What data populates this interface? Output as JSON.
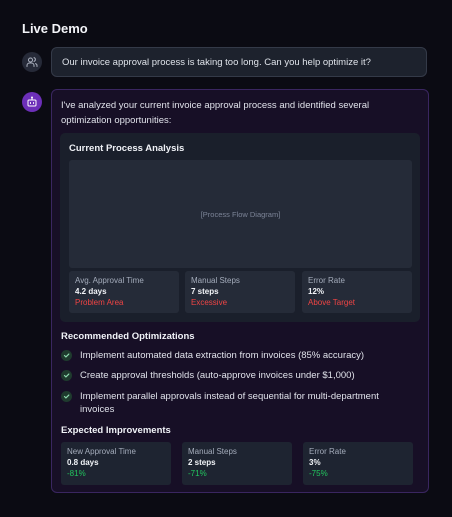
{
  "panel": {
    "title": "Live Demo"
  },
  "user_message": {
    "text": "Our invoice approval process is taking too long. Can you help optimize it?"
  },
  "assistant": {
    "intro": "I've analyzed your current invoice approval process and identified several optimization opportunities:",
    "analysis": {
      "title": "Current Process Analysis",
      "diagram_placeholder": "[Process Flow Diagram]",
      "metrics": [
        {
          "label": "Avg. Approval Time",
          "value": "4.2 days",
          "status": "Problem Area"
        },
        {
          "label": "Manual Steps",
          "value": "7 steps",
          "status": "Excessive"
        },
        {
          "label": "Error Rate",
          "value": "12%",
          "status": "Above Target"
        }
      ]
    },
    "optimizations": {
      "title": "Recommended Optimizations",
      "items": [
        "Implement automated data extraction from invoices (85% accuracy)",
        "Create approval thresholds (auto-approve invoices under $1,000)",
        "Implement parallel approvals instead of sequential for multi-department invoices"
      ]
    },
    "improvements": {
      "title": "Expected Improvements",
      "items": [
        {
          "label": "New Approval Time",
          "value": "0.8 days",
          "change": "-81%"
        },
        {
          "label": "Manual Steps",
          "value": "2 steps",
          "change": "-71%"
        },
        {
          "label": "Error Rate",
          "value": "3%",
          "change": "-75%"
        }
      ]
    }
  },
  "colors": {
    "accent": "#6c2fb8",
    "problem": "#ef4444",
    "positive": "#22c55e"
  }
}
